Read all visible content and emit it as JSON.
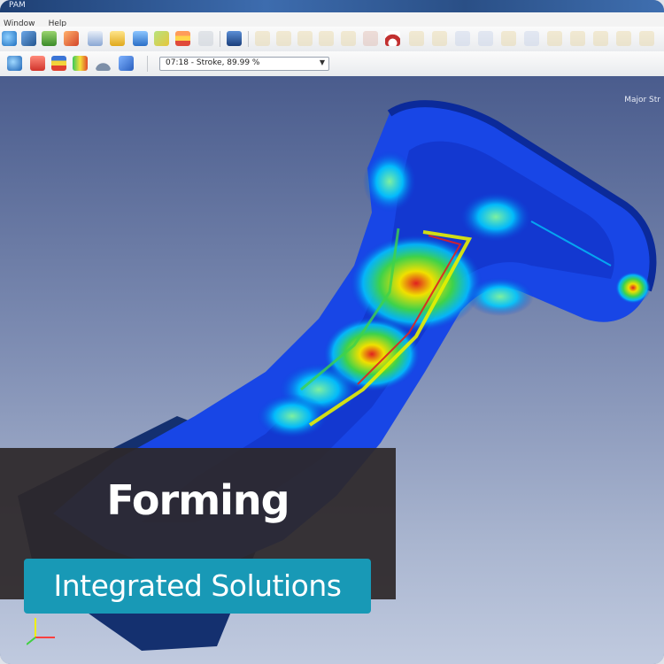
{
  "window": {
    "title": "PAM"
  },
  "menu": {
    "items": [
      "Window",
      "Help"
    ]
  },
  "toolbar": {
    "step_select": {
      "value": "07:18 - Stroke, 89.99 %"
    }
  },
  "viewport": {
    "legend_label": "Major Str"
  },
  "caption": {
    "title": "Forming",
    "subtitle": "Integrated Solutions"
  },
  "colors": {
    "caption_bg": "#2d282a",
    "pill_bg": "#1899b6",
    "contour_low": "#0a3dd9",
    "contour_mid": "#00d4ff",
    "contour_high": "#e8f000",
    "contour_peak": "#e02020"
  }
}
